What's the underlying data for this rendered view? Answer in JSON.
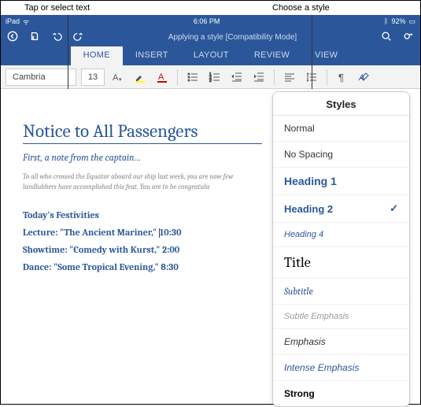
{
  "callouts": {
    "left": "Tap or select text",
    "right": "Choose a style"
  },
  "status": {
    "carrier": "iPad",
    "wifi": "≈",
    "time": "6:06 PM",
    "bt": "92%",
    "battIcon": "▮"
  },
  "titlebar": {
    "doc_title": "Applying a style [Compatibility Mode]"
  },
  "tabs": [
    "HOME",
    "INSERT",
    "LAYOUT",
    "REVIEW",
    "VIEW"
  ],
  "ribbon": {
    "font": "Cambria",
    "size": "13"
  },
  "doc": {
    "h1": "Notice to All Passengers",
    "subtitle": "First, a note from the captain…",
    "body_small": "To all who crossed the Equator aboard our ship last week, you are now\nfew landlubbers have accomplished this feat. You are to be congratula",
    "h2": "Today's Festivities",
    "e1a": "Lecture: \"The Ancient Mariner,\" ",
    "e1b": "10:30",
    "e2": "Showtime: \"Comedy with Kurst,\" 2:00",
    "e3": "Dance: \"Some Tropical Evening,\" 8:30"
  },
  "styles": {
    "header": "Styles",
    "items": [
      {
        "label": "Normal",
        "cls": "normal"
      },
      {
        "label": "No Spacing",
        "cls": "normal"
      },
      {
        "label": "Heading 1",
        "cls": "heading1"
      },
      {
        "label": "Heading 2",
        "cls": "heading2",
        "selected": true
      },
      {
        "label": "Heading 4",
        "cls": "heading4"
      },
      {
        "label": "Title",
        "cls": "title-style"
      },
      {
        "label": "Subtitle",
        "cls": "subtitle-style"
      },
      {
        "label": "Subtle Emphasis",
        "cls": "subtle-emph"
      },
      {
        "label": "Emphasis",
        "cls": "emphasis"
      },
      {
        "label": "Intense Emphasis",
        "cls": "intense-emph"
      },
      {
        "label": "Strong",
        "cls": "strong"
      }
    ]
  }
}
